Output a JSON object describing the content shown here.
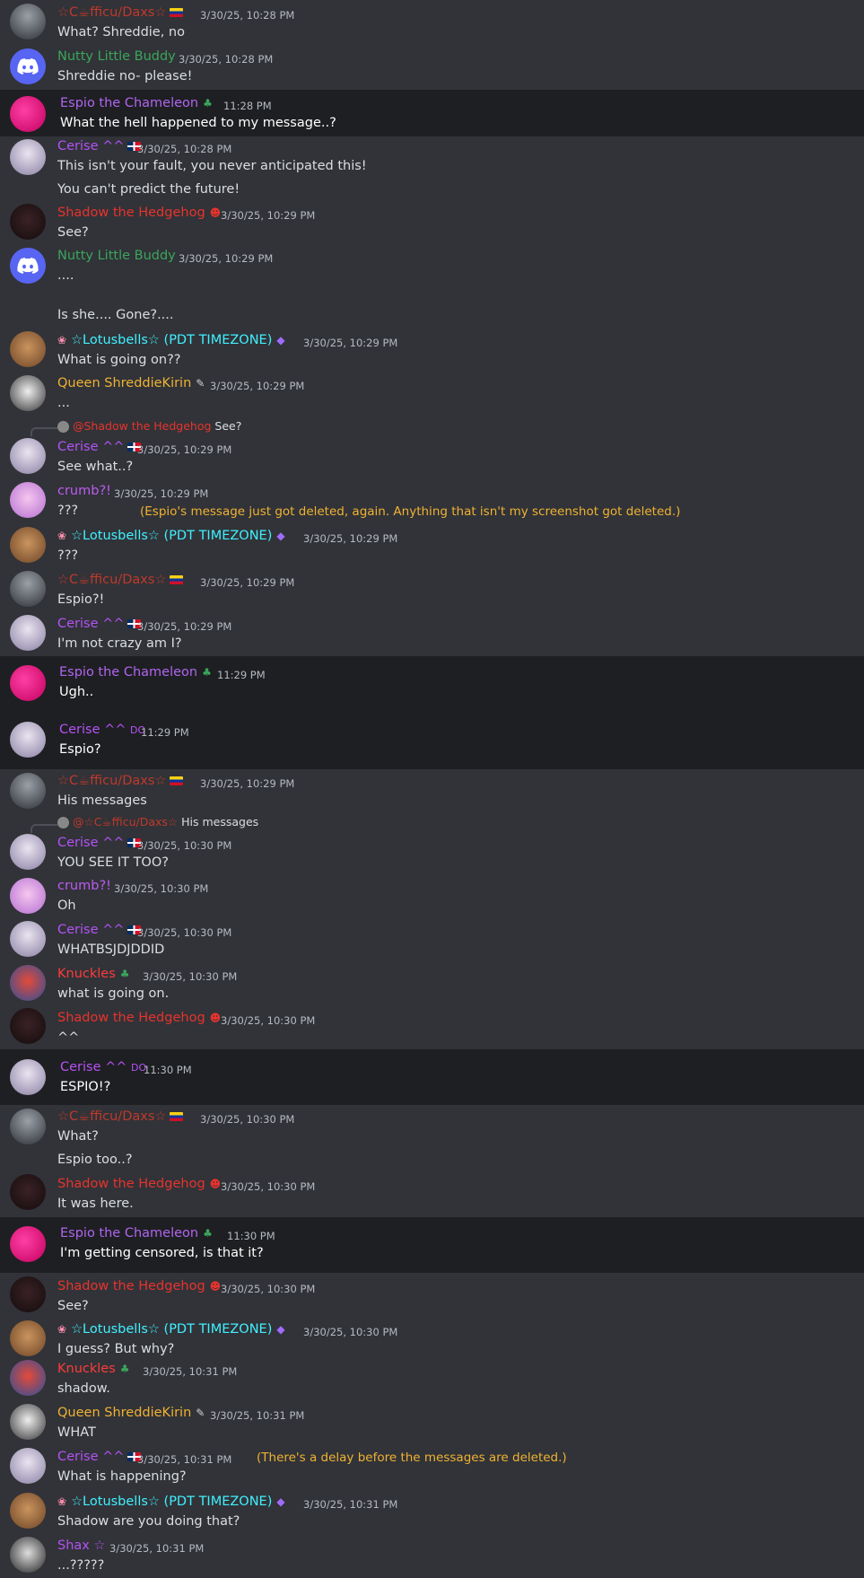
{
  "colors": {
    "background": "#313338",
    "dark_band": "#1e1f22",
    "note": "#f0b232"
  },
  "icons": {
    "discord": "discord-logo-icon",
    "clover": "clover-icon",
    "gem": "gem-icon",
    "flower": "flower-icon"
  },
  "m01": {
    "name": "☆C☕fficu/Daxs☆",
    "ts": "3/30/25, 10:28 PM",
    "text": "What? Shreddie, no"
  },
  "m02": {
    "name": "Nutty Little Buddy",
    "ts": "3/30/25, 10:28 PM",
    "text": "Shreddie no- please!"
  },
  "m03": {
    "name": "Espio the Chameleon",
    "ts": "11:28 PM",
    "text": "What the hell happened to my message..?"
  },
  "m04": {
    "name": "Cerise ^^",
    "ts": "3/30/25, 10:28 PM",
    "text1": "This isn't your fault, you never anticipated this!",
    "text2": "You can't predict the future!"
  },
  "m05": {
    "name": "Shadow the Hedgehog",
    "ts": "3/30/25, 10:29 PM",
    "text": "See?"
  },
  "m06": {
    "name": "Nutty Little Buddy",
    "ts": "3/30/25, 10:29 PM",
    "text1": "....",
    "text2": "Is she.... Gone?...."
  },
  "m07": {
    "name": "☆Lotusbells☆ (PDT TIMEZONE)",
    "ts": "3/30/25, 10:29 PM",
    "text": "What is going on??"
  },
  "m08": {
    "name": "Queen ShreddieKirin",
    "ts": "3/30/25, 10:29 PM",
    "text": "..."
  },
  "m09": {
    "reply_name": "@Shadow the Hedgehog",
    "reply_text": "See?",
    "name": "Cerise ^^",
    "ts": "3/30/25, 10:29 PM",
    "text": "See what..?"
  },
  "m10": {
    "name": "crumb?!",
    "ts": "3/30/25, 10:29 PM",
    "text": "???",
    "note": "(Espio's message just got deleted, again. Anything that isn't my screenshot got deleted.)"
  },
  "m11": {
    "name": "☆Lotusbells☆ (PDT TIMEZONE)",
    "ts": "3/30/25, 10:29 PM",
    "text": "???"
  },
  "m12": {
    "name": "☆C☕fficu/Daxs☆",
    "ts": "3/30/25, 10:29 PM",
    "text": "Espio?!"
  },
  "m13": {
    "name": "Cerise ^^",
    "ts": "3/30/25, 10:29 PM",
    "text": "I'm not crazy am I?"
  },
  "m14": {
    "name": "Espio the Chameleon",
    "ts": "11:29 PM",
    "text": "Ugh.."
  },
  "m15": {
    "name": "Cerise ^^",
    "tag": "DO",
    "ts": "11:29 PM",
    "text": "Espio?"
  },
  "m16": {
    "name": "☆C☕fficu/Daxs☆",
    "ts": "3/30/25, 10:29 PM",
    "text": "His messages"
  },
  "m17": {
    "reply_name": "@☆C☕fficu/Daxs☆",
    "reply_text": "His messages",
    "name": "Cerise ^^",
    "ts": "3/30/25, 10:30 PM",
    "text": "YOU SEE IT TOO?"
  },
  "m18": {
    "name": "crumb?!",
    "ts": "3/30/25, 10:30 PM",
    "text": "Oh"
  },
  "m19": {
    "name": "Cerise ^^",
    "ts": "3/30/25, 10:30 PM",
    "text": "WHATBSJDJDDID"
  },
  "m20": {
    "name": "Knuckles",
    "ts": "3/30/25, 10:30 PM",
    "text": "what is going on."
  },
  "m21": {
    "name": "Shadow the Hedgehog",
    "ts": "3/30/25, 10:30 PM",
    "text": "^^"
  },
  "m22": {
    "name": "Cerise ^^",
    "tag": "DO",
    "ts": "11:30 PM",
    "text": "ESPIO!?"
  },
  "m23": {
    "name": "☆C☕fficu/Daxs☆",
    "ts": "3/30/25, 10:30 PM",
    "text1": "What?",
    "text2": "Espio too..?"
  },
  "m24": {
    "name": "Shadow the Hedgehog",
    "ts": "3/30/25, 10:30 PM",
    "text": "It was here."
  },
  "m25": {
    "name": "Espio the Chameleon",
    "ts": "11:30 PM",
    "text": "I'm getting censored, is that it?"
  },
  "m26": {
    "name": "Shadow the Hedgehog",
    "ts": "3/30/25, 10:30 PM",
    "text": "See?"
  },
  "m27": {
    "name": "☆Lotusbells☆ (PDT TIMEZONE)",
    "ts": "3/30/25, 10:30 PM",
    "text": "I guess? But why?"
  },
  "m28": {
    "name": "Knuckles",
    "ts": "3/30/25, 10:31 PM",
    "text": "shadow."
  },
  "m29": {
    "name": "Queen ShreddieKirin",
    "ts": "3/30/25, 10:31 PM",
    "text": "WHAT"
  },
  "m30": {
    "name": "Cerise ^^",
    "ts": "3/30/25, 10:31 PM",
    "text": "What is happening?",
    "note": "(There's a delay before the messages are deleted.)"
  },
  "m31": {
    "name": "☆Lotusbells☆ (PDT TIMEZONE)",
    "ts": "3/30/25, 10:31 PM",
    "text": "Shadow are you doing that?"
  },
  "m32": {
    "name": "Shax ☆",
    "ts": "3/30/25, 10:31 PM",
    "text": "...?????"
  }
}
